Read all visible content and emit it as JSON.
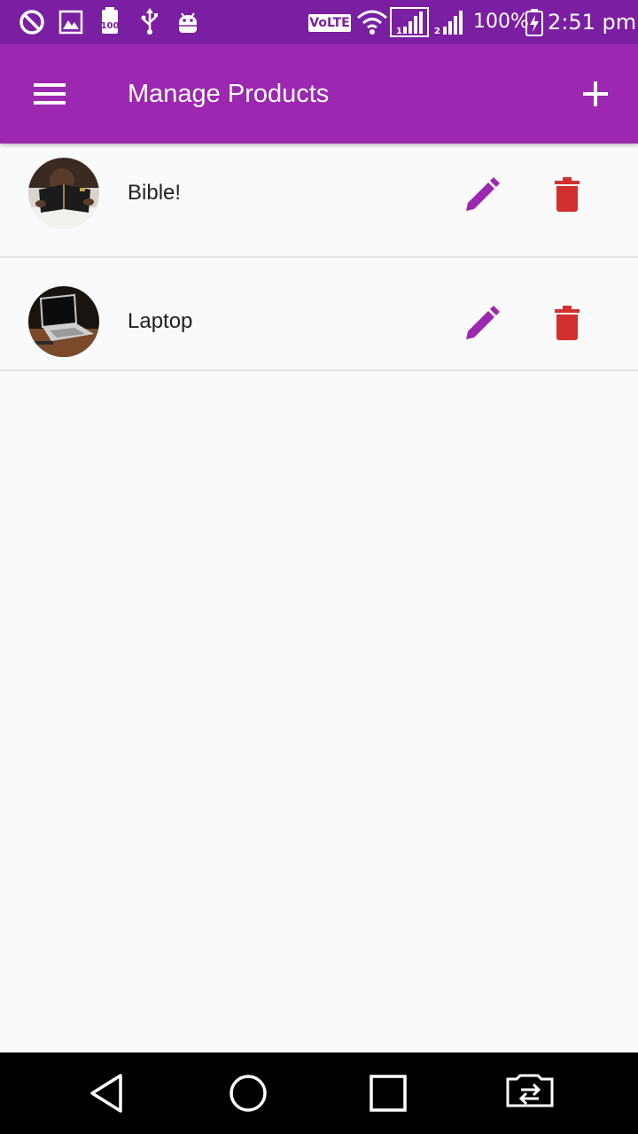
{
  "status_bar": {
    "network_badge": "VoLTE",
    "battery_percent": "100%",
    "time": "2:51 pm",
    "notification_icons": [
      "do-not-disturb-icon",
      "gallery-icon",
      "storage-100-icon",
      "usb-icon",
      "android-debug-icon"
    ],
    "indicator_icons": [
      "wifi-icon",
      "signal-sim1-icon",
      "signal-sim2-icon",
      "battery-charging-icon"
    ]
  },
  "app_bar": {
    "title": "Manage Products",
    "menu_icon": "menu-icon",
    "add_icon": "add-icon",
    "color": "#9c27b0"
  },
  "products": [
    {
      "name": "Bible!",
      "image": "bible-photo",
      "edit_icon": "edit-icon",
      "delete_icon": "delete-icon"
    },
    {
      "name": "Laptop",
      "image": "laptop-photo",
      "edit_icon": "edit-icon",
      "delete_icon": "delete-icon"
    }
  ],
  "colors": {
    "status_bar": "#7b1fa2",
    "accent": "#9c27b0",
    "delete": "#d32f2f"
  },
  "nav_bar": {
    "buttons": [
      "back-icon",
      "home-icon",
      "recents-icon",
      "switch-sim-icon"
    ]
  }
}
